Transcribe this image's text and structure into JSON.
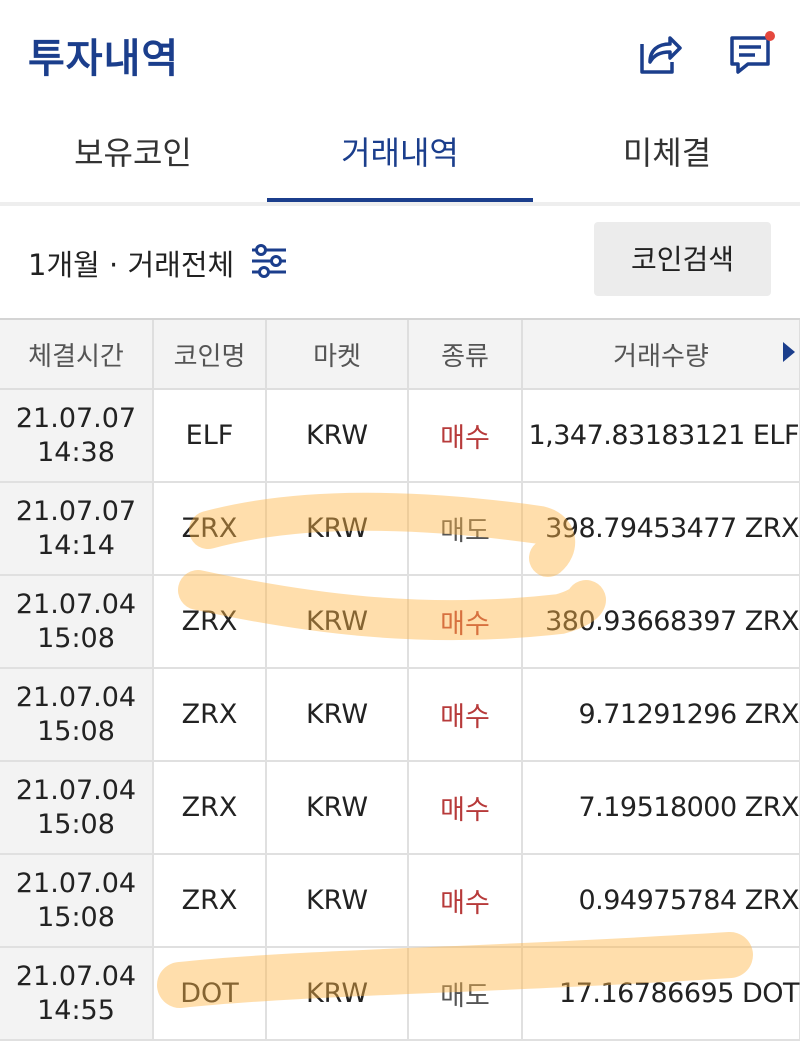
{
  "header": {
    "title": "투자내역",
    "share_icon": "share-icon",
    "chat_icon": "chat-bubble-icon",
    "notification_dot_color": "#e5483e"
  },
  "tabs": [
    {
      "label": "보유코인",
      "active": false
    },
    {
      "label": "거래내역",
      "active": true
    },
    {
      "label": "미체결",
      "active": false
    }
  ],
  "filter": {
    "label": "1개월 · 거래전체",
    "icon": "filter-sliders-icon",
    "search_button": "코인검색"
  },
  "table": {
    "headers": [
      "체결시간",
      "코인명",
      "마켓",
      "종류",
      "거래수량"
    ],
    "rows": [
      {
        "date": "21.07.07",
        "time": "14:38",
        "coin": "ELF",
        "market": "KRW",
        "type": "매수",
        "qty": "1,347.83183121 ELF"
      },
      {
        "date": "21.07.07",
        "time": "14:14",
        "coin": "ZRX",
        "market": "KRW",
        "type": "매도",
        "qty": "398.79453477 ZRX"
      },
      {
        "date": "21.07.04",
        "time": "15:08",
        "coin": "ZRX",
        "market": "KRW",
        "type": "매수",
        "qty": "380.93668397 ZRX"
      },
      {
        "date": "21.07.04",
        "time": "15:08",
        "coin": "ZRX",
        "market": "KRW",
        "type": "매수",
        "qty": "9.71291296 ZRX"
      },
      {
        "date": "21.07.04",
        "time": "15:08",
        "coin": "ZRX",
        "market": "KRW",
        "type": "매수",
        "qty": "7.19518000 ZRX"
      },
      {
        "date": "21.07.04",
        "time": "15:08",
        "coin": "ZRX",
        "market": "KRW",
        "type": "매수",
        "qty": "0.94975784 ZRX"
      },
      {
        "date": "21.07.04",
        "time": "14:55",
        "coin": "DOT",
        "market": "KRW",
        "type": "매도",
        "qty": "17.16786695 DOT"
      }
    ]
  },
  "colors": {
    "brand": "#1b3e8c",
    "buy": "#b73a3a",
    "sell": "#555555",
    "highlight": "#ffc266"
  }
}
